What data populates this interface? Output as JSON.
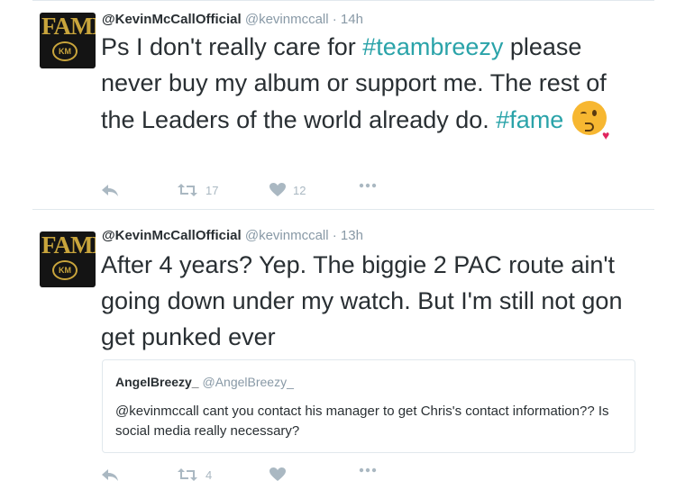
{
  "tweets": [
    {
      "name": "@KevinMcCallOfficial",
      "handle": "@kevinmccall",
      "time": "· 14h",
      "avatar": {
        "logo": "FAME",
        "badge": "KM"
      },
      "text": {
        "p1": "Ps I don't really care for ",
        "tag1": "#teambreezy",
        "p2": " please never buy my album or support me. The rest of the Leaders of the world already do. ",
        "tag2": "#fame"
      },
      "emoji": "kissing-face-with-heart",
      "retweets": "17",
      "likes": "12"
    },
    {
      "name": "@KevinMcCallOfficial",
      "handle": "@kevinmccall",
      "time": "· 13h",
      "avatar": {
        "logo": "FAME",
        "badge": "KM"
      },
      "text": "After 4 years? Yep. The biggie 2 PAC route ain't going down under my watch. But I'm still not gon get punked ever",
      "quote": {
        "name": "AngelBreezy_",
        "handle": "@AngelBreezy_",
        "text": "@kevinmccall cant you contact his manager to get Chris's contact information?? Is social media really necessary?"
      },
      "retweets": "4",
      "likes": ""
    }
  ],
  "colors": {
    "hashtag": "#2aa3a9",
    "muted": "#8899a6",
    "icon": "#aab8c2",
    "text": "#292f33"
  },
  "icons": [
    "reply-icon",
    "retweet-icon",
    "like-icon",
    "more-icon"
  ]
}
